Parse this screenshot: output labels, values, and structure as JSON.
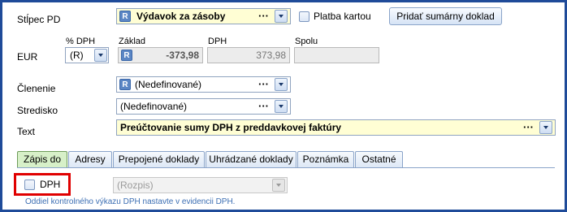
{
  "row1": {
    "label": "Stĺpec PD",
    "value": "Výdavok za zásoby",
    "value_icon": "R",
    "dots": "···",
    "checkbox_label": "Platba kartou",
    "button_label": "Pridať sumárny doklad"
  },
  "amounts": {
    "currency_label": "EUR",
    "vat_pct_header": "% DPH",
    "vat_pct_value": "(R)",
    "base_header": "Základ",
    "base_icon": "R",
    "base_value": "-373,98",
    "vat_header": "DPH",
    "vat_value": "373,98",
    "total_header": "Spolu",
    "total_value": ""
  },
  "row_clenenie": {
    "label": "Členenie",
    "value": "(Nedefinované)",
    "value_icon": "R",
    "dots": "···"
  },
  "row_stredisko": {
    "label": "Stredisko",
    "value": "(Nedefinované)",
    "dots": "···"
  },
  "row_text": {
    "label": "Text",
    "value": "Preúčtovanie sumy DPH z preddavkovej faktúry",
    "dots": "···"
  },
  "tabs": [
    {
      "label": "Zápis do",
      "active": true
    },
    {
      "label": "Adresy",
      "active": false
    },
    {
      "label": "Prepojené doklady",
      "active": false
    },
    {
      "label": "Uhrádzané doklady",
      "active": false
    },
    {
      "label": "Poznámka",
      "active": false
    },
    {
      "label": "Ostatné",
      "active": false
    }
  ],
  "panel": {
    "dph_checkbox_label": "DPH",
    "dph_checked": false,
    "rozpis_value": "(Rozpis)",
    "note": "Oddiel kontrolného výkazu DPH nastavte v evidencii DPH."
  },
  "colors": {
    "frame": "#1f4b99",
    "field_yellow": "#fffed4",
    "highlight_red": "#e00000",
    "active_tab": "#d7f0c8",
    "note_text": "#3d6fb3"
  },
  "icons": [
    "dropdown-chevron-icon",
    "r-badge-icon",
    "ellipsis-icon",
    "checkbox-icon"
  ]
}
